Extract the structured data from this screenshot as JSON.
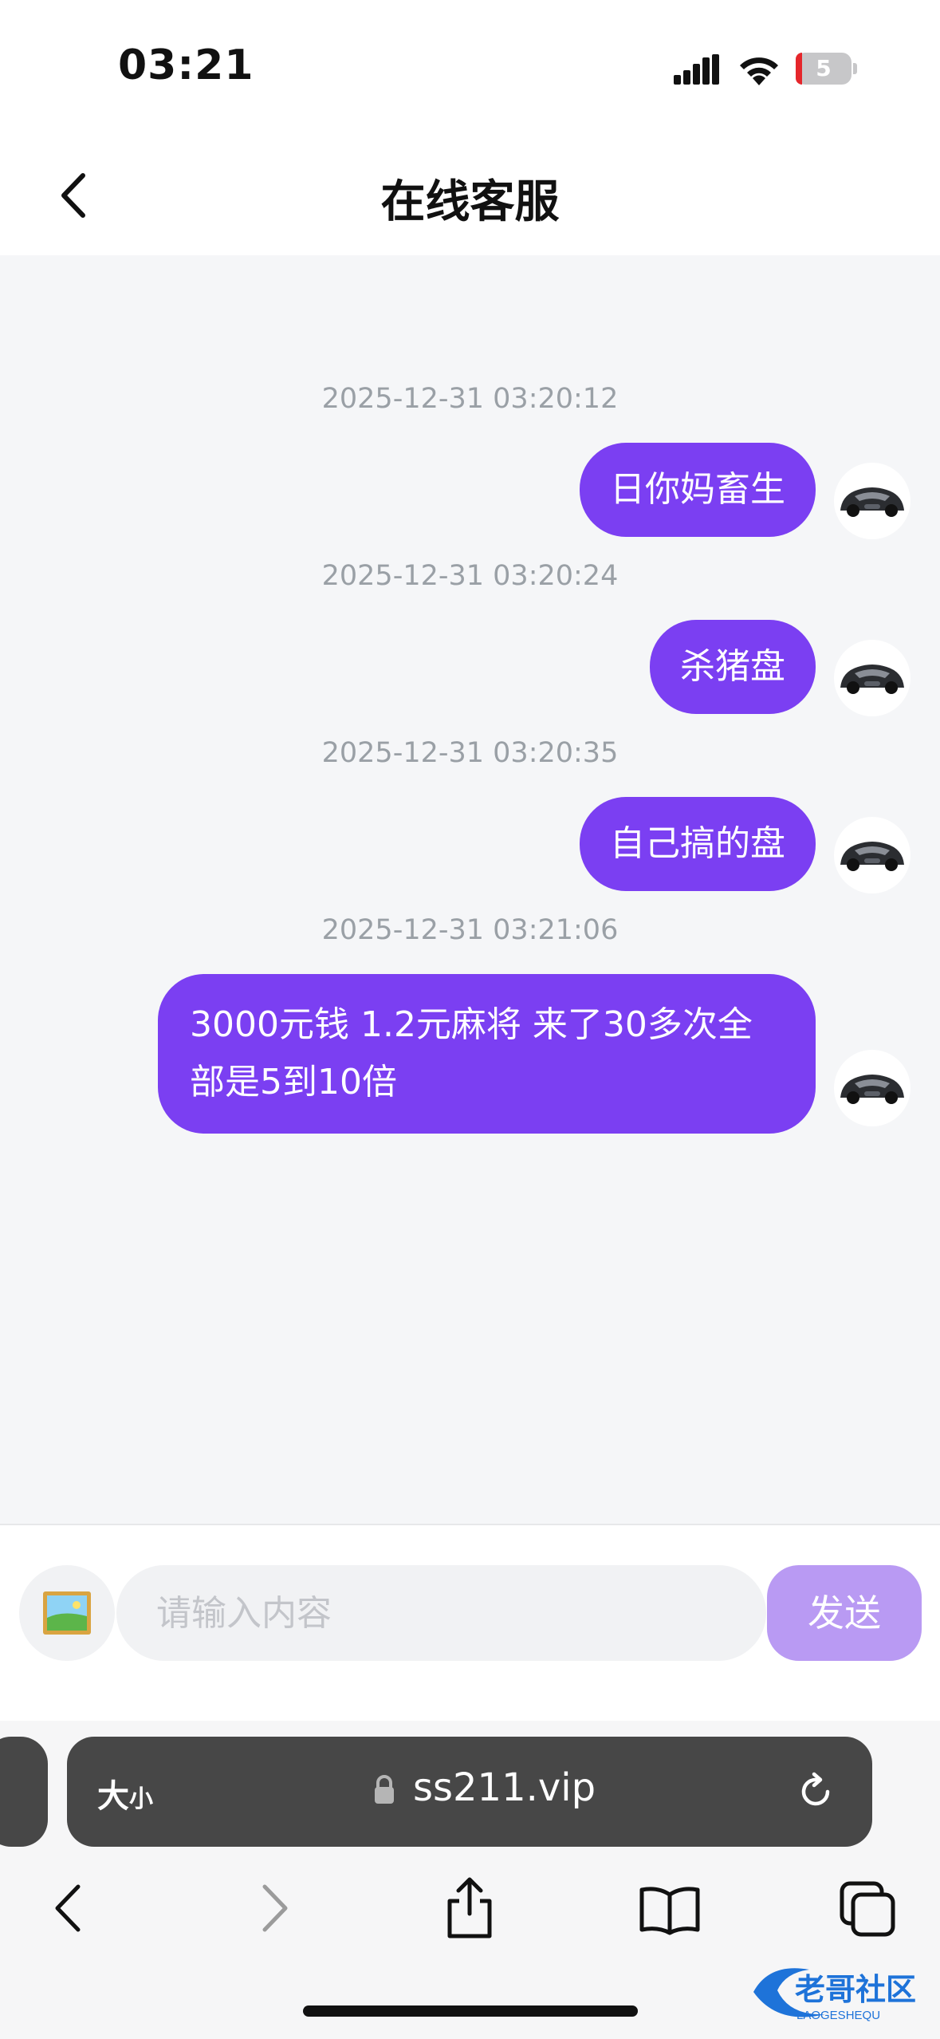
{
  "status_bar": {
    "time": "03:21",
    "battery_level": "5",
    "icons": [
      "signal-icon",
      "wifi-icon",
      "battery-icon"
    ]
  },
  "header": {
    "title": "在线客服",
    "back_icon": "chevron-left-icon"
  },
  "chat": {
    "messages": [
      {
        "timestamp": "2025-12-31 03:20:12",
        "text": "日你妈畜生",
        "sender": "me"
      },
      {
        "timestamp": "2025-12-31 03:20:24",
        "text": "杀猪盘",
        "sender": "me"
      },
      {
        "timestamp": "2025-12-31 03:20:35",
        "text": "自己搞的盘",
        "sender": "me"
      },
      {
        "timestamp": "2025-12-31 03:21:06",
        "text": "3000元钱 1.2元麻将 来了30多次全部是5到10倍",
        "sender": "me"
      }
    ]
  },
  "composer": {
    "placeholder": "请输入内容",
    "send_label": "发送",
    "image_icon": "image-icon"
  },
  "browser": {
    "text_size_big": "大",
    "text_size_small": "小",
    "url": "ss211.vip",
    "toolbar_icons": [
      "back-icon",
      "forward-icon",
      "share-icon",
      "bookmarks-icon",
      "tabs-icon"
    ]
  },
  "watermark": {
    "text": "老哥社区",
    "subtext": "LAOGESHEQU"
  },
  "colors": {
    "bubble": "#7b3ff2",
    "send_button": "#b99af3",
    "background": "#f5f6f8"
  }
}
